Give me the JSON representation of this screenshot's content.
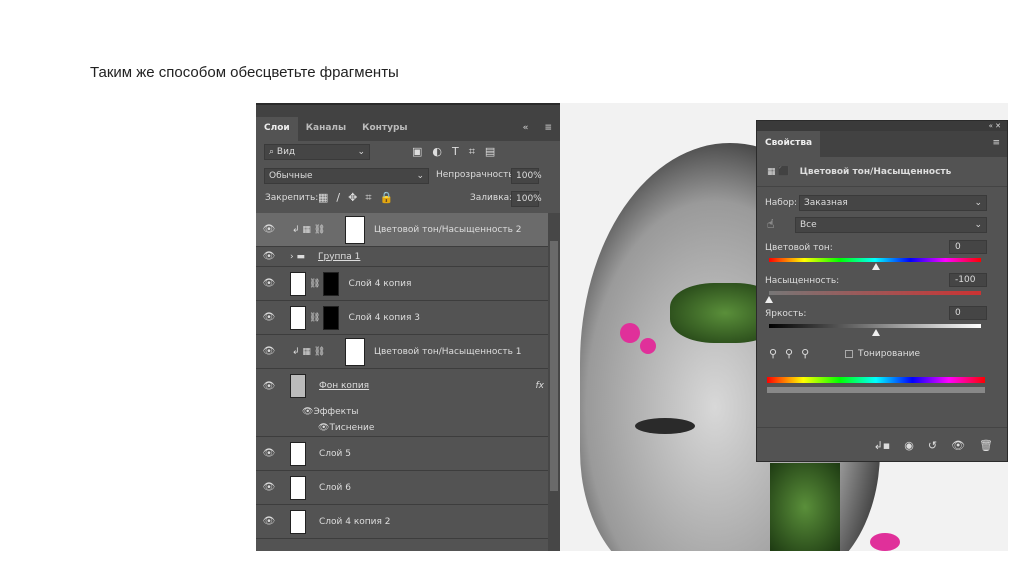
{
  "slide_title": "Таким же способом обесцветьте фрагменты",
  "layers_panel": {
    "tabs": [
      "Слои",
      "Каналы",
      "Контуры"
    ],
    "filter_label": "Вид",
    "blend_mode": "Обычные",
    "opacity_label": "Непрозрачность:",
    "opacity_value": "100%",
    "lock_label": "Закрепить:",
    "fill_label": "Заливка:",
    "fill_value": "100%",
    "layers": [
      {
        "name": "Цветовой тон/Насыщенность 2"
      },
      {
        "name": "Группа 1"
      },
      {
        "name": "Слой 4 копия"
      },
      {
        "name": "Слой 4 копия 3"
      },
      {
        "name": "Цветовой тон/Насыщенность 1"
      },
      {
        "name": "Фон копия",
        "fx": "fx"
      },
      {
        "name": "Эффекты"
      },
      {
        "name": "Тиснение"
      },
      {
        "name": "Слой 5"
      },
      {
        "name": "Слой 6"
      },
      {
        "name": "Слой 4 копия 2"
      }
    ]
  },
  "properties_panel": {
    "tab": "Свойства",
    "adjustment_title": "Цветовой тон/Насыщенность",
    "preset_label": "Набор:",
    "preset_value": "Заказная",
    "channel_value": "Все",
    "hue_label": "Цветовой тон:",
    "hue_value": "0",
    "saturation_label": "Насыщенность:",
    "saturation_value": "-100",
    "lightness_label": "Яркость:",
    "lightness_value": "0",
    "colorize_label": "Тонирование"
  }
}
